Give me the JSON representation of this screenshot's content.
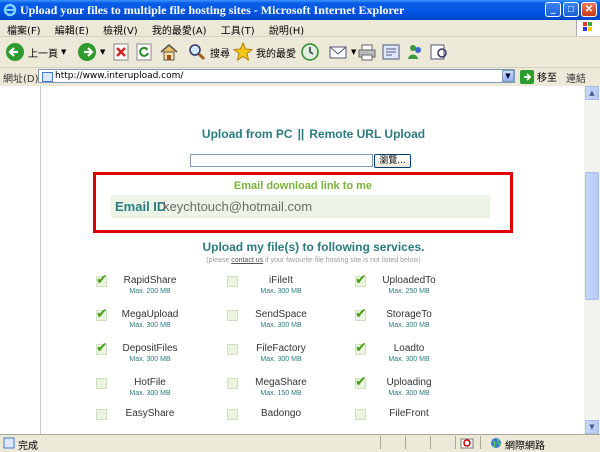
{
  "window": {
    "title": "Upload your files to multiple file hosting sites - Microsoft Internet Explorer"
  },
  "menu": [
    "檔案(F)",
    "編輯(E)",
    "檢視(V)",
    "我的最愛(A)",
    "工具(T)",
    "說明(H)"
  ],
  "toolbar": {
    "back_label": "上一頁",
    "search_label": "搜尋",
    "favorites_label": "我的最愛"
  },
  "address": {
    "label": "網址(D)",
    "url": "http://www.interupload.com/",
    "go_label": "移至",
    "links_label": "連結"
  },
  "page": {
    "upload_pc": "Upload from PC",
    "separator": "||",
    "remote_url": "Remote URL Upload",
    "browse_label": "瀏覽...",
    "email_title": "Email download link to me",
    "email_label": "Email ID",
    "email_value": "keychtouch@hotmail.com",
    "services_title": "Upload my file(s) to following services.",
    "note_pre": "(please ",
    "note_link": "contact us",
    "note_post": " if your favourite file hosting site is not listed below)"
  },
  "services": [
    {
      "name": "RapidShare",
      "max": "Max. 200 MB",
      "checked": true
    },
    {
      "name": "iFileIt",
      "max": "Max. 300 MB",
      "checked": false
    },
    {
      "name": "UploadedTo",
      "max": "Max. 250 MB",
      "checked": true
    },
    {
      "name": "MegaUpload",
      "max": "Max. 300 MB",
      "checked": true
    },
    {
      "name": "SendSpace",
      "max": "Max. 300 MB",
      "checked": false
    },
    {
      "name": "StorageTo",
      "max": "Max. 300 MB",
      "checked": true
    },
    {
      "name": "DepositFiles",
      "max": "Max. 300 MB",
      "checked": true
    },
    {
      "name": "FileFactory",
      "max": "Max. 300 MB",
      "checked": false
    },
    {
      "name": "Loadto",
      "max": "Max. 300 MB",
      "checked": true
    },
    {
      "name": "HotFile",
      "max": "Max. 300 MB",
      "checked": false
    },
    {
      "name": "MegaShare",
      "max": "Max. 150 MB",
      "checked": false
    },
    {
      "name": "Uploading",
      "max": "Max. 300 MB",
      "checked": true
    },
    {
      "name": "EasyShare",
      "max": "",
      "checked": false
    },
    {
      "name": "Badongo",
      "max": "",
      "checked": false
    },
    {
      "name": "FileFront",
      "max": "",
      "checked": false
    }
  ],
  "status": {
    "text": "完成",
    "zone": "網際網路"
  }
}
